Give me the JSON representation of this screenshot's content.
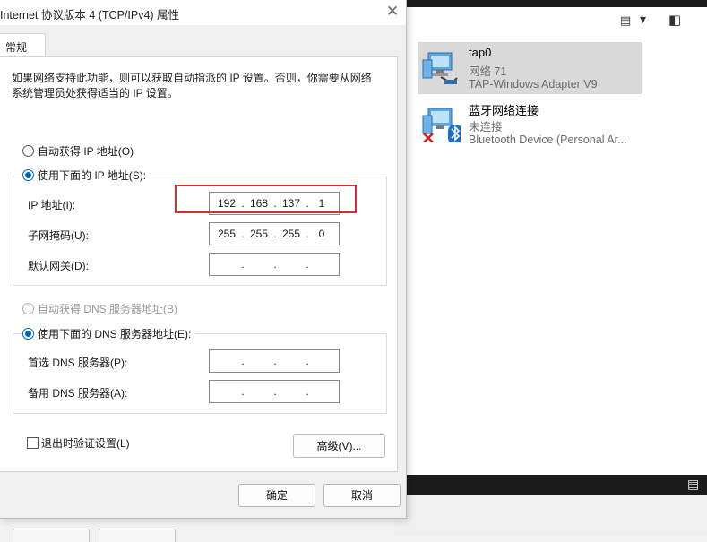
{
  "dialog": {
    "title": "Internet 协议版本 4 (TCP/IPv4) 属性",
    "close_glyph": "✕",
    "tab_label": "常规",
    "description": "如果网络支持此功能，则可以获取自动指派的 IP 设置。否则，你需要从网络系统管理员处获得适当的 IP 设置。",
    "auto_ip_label": "自动获得 IP 地址(O)",
    "manual_ip_label": "使用下面的 IP 地址(S):",
    "ip_label": "IP 地址(I):",
    "ip": {
      "a": "192",
      "b": "168",
      "c": "137",
      "d": "1"
    },
    "subnet_label": "子网掩码(U):",
    "subnet": {
      "a": "255",
      "b": "255",
      "c": "255",
      "d": "0"
    },
    "gateway_label": "默认网关(D):",
    "auto_dns_label": "自动获得 DNS 服务器地址(B)",
    "manual_dns_label": "使用下面的 DNS 服务器地址(E):",
    "preferred_dns_label": "首选 DNS 服务器(P):",
    "alternate_dns_label": "备用 DNS 服务器(A):",
    "dot": ".",
    "validate_label": "退出时验证设置(L)",
    "advanced_label": "高级(V)...",
    "ok_label": "确定",
    "cancel_label": "取消",
    "highlight_color": "#d32f2f",
    "accent_color": "#0067c0"
  },
  "network": {
    "toolbar": {
      "view_icon": "details-view-icon",
      "view_glyph": "▤",
      "dropdown_glyph": "▾",
      "pane_icon": "preview-pane-icon",
      "pane_glyph": "◧"
    },
    "adapters": [
      {
        "name": "tap0",
        "status": "网络 71",
        "device": "TAP-Windows Adapter V9",
        "icon": "network-adapter-icon"
      },
      {
        "name": "蓝牙网络连接",
        "status": "未连接",
        "device": "Bluetooth Device (Personal Ar...",
        "icon": "bluetooth-adapter-icon",
        "status_icon": "disconnected-x-icon"
      }
    ],
    "status_glyph": "▤"
  }
}
